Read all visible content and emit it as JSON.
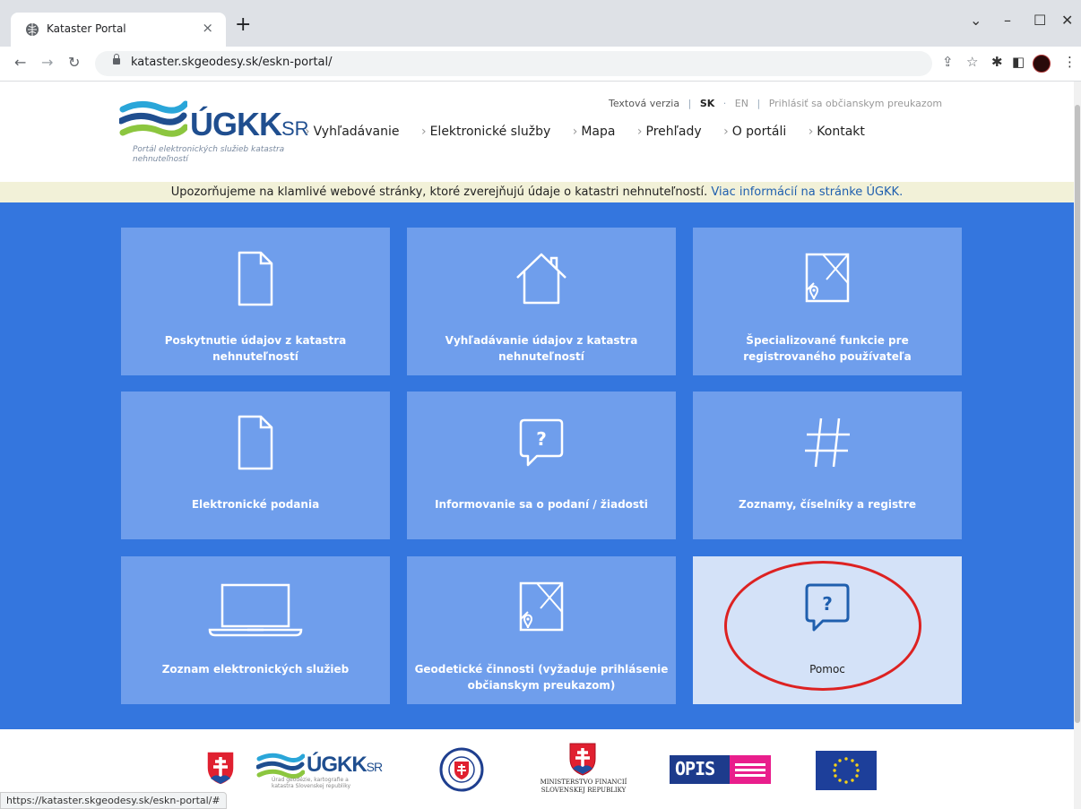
{
  "browser": {
    "tab_title": "Kataster Portal",
    "tab_close": "×",
    "new_tab": "+",
    "url": "kataster.skgeodesy.sk/eskn-portal/",
    "status_url": "https://kataster.skgeodesy.sk/eskn-portal/#"
  },
  "header": {
    "logo_text": "ÚGKK",
    "logo_sr": "SR",
    "logo_tagline": "Portál elektronických služieb katastra nehnuteľností",
    "top_links": {
      "text_version": "Textová verzia",
      "sk": "SK",
      "en": "EN",
      "login": "Prihlásiť sa občianskym preukazom"
    },
    "nav": [
      "Vyhľadávanie",
      "Elektronické služby",
      "Mapa",
      "Prehľady",
      "O portáli",
      "Kontakt"
    ]
  },
  "notice": {
    "text": "Upozorňujeme na klamlivé webové stránky, ktoré zverejňujú údaje o katastri nehnuteľností.",
    "link": "Viac informácií na stránke ÚGKK."
  },
  "tiles": [
    {
      "label": "Poskytnutie údajov z katastra nehnuteľností",
      "icon": "document-icon"
    },
    {
      "label": "Vyhľadávanie údajov z katastra nehnuteľností",
      "icon": "house-icon"
    },
    {
      "label": "Špecializované funkcie pre registrovaného používateľa",
      "icon": "map-pin-icon"
    },
    {
      "label": "Elektronické podania",
      "icon": "document-icon"
    },
    {
      "label": "Informovanie sa o podaní / žiadosti",
      "icon": "help-bubble-icon"
    },
    {
      "label": "Zoznamy, číselníky a registre",
      "icon": "hashtag-icon"
    },
    {
      "label": "Zoznam elektronických služieb",
      "icon": "laptop-icon"
    },
    {
      "label": "Geodetické činnosti (vyžaduje prihlásenie občianskym preukazom)",
      "icon": "map-pin-icon"
    },
    {
      "label": "Pomoc",
      "icon": "help-bubble-icon"
    }
  ],
  "footer": {
    "ugkk_text": "ÚGKK",
    "ugkk_sr": "SR",
    "ugkk_caption": "Úrad geodézie, kartografie a katastra Slovenskej republiky",
    "ministry_caption": "MINISTERSTVO FINANCIÍ SLOVENSKEJ REPUBLIKY",
    "opis_text": "OPIS"
  },
  "colors": {
    "tile_bg": "#6f9eec",
    "tile_active_bg": "#d4e2f8",
    "main_bg": "#3476de",
    "brand_blue": "#1f4e8f",
    "annotation_red": "#dd2222"
  }
}
